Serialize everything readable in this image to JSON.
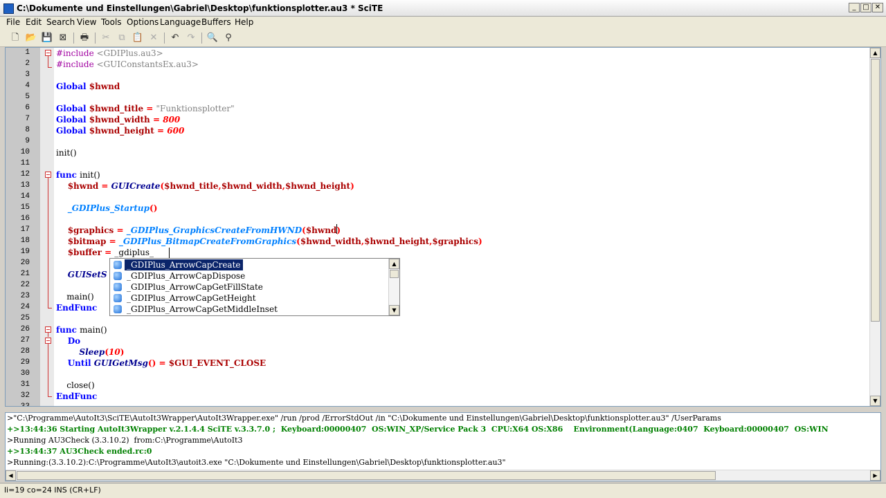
{
  "window": {
    "title": "C:\\Dokumente und Einstellungen\\Gabriel\\Desktop\\funktionsplotter.au3 * SciTE",
    "minimize": "_",
    "maximize": "□",
    "close": "✕"
  },
  "menu": [
    "File",
    "Edit",
    "Search",
    "View",
    "Tools",
    "Options",
    "Language",
    "Buffers",
    "Help"
  ],
  "toolbar": {
    "icons": [
      "new-file-icon",
      "open-icon",
      "save-icon",
      "close-file-icon",
      "print-icon",
      "cut-icon",
      "copy-icon",
      "paste-icon",
      "delete-icon",
      "undo-icon",
      "redo-icon",
      "find-icon",
      "replace-icon"
    ]
  },
  "editor": {
    "lines": [
      [
        {
          "t": "#include ",
          "c": "pre"
        },
        {
          "t": "<GDIPlus.au3>",
          "c": "str"
        }
      ],
      [
        {
          "t": "#include ",
          "c": "pre"
        },
        {
          "t": "<GUIConstantsEx.au3>",
          "c": "str"
        }
      ],
      [],
      [
        {
          "t": "Global ",
          "c": "kw"
        },
        {
          "t": "$hwnd",
          "c": "var"
        }
      ],
      [],
      [
        {
          "t": "Global ",
          "c": "kw"
        },
        {
          "t": "$hwnd_title",
          "c": "var"
        },
        {
          "t": " = ",
          "c": "op"
        },
        {
          "t": "\"Funktionsplotter\"",
          "c": "str"
        }
      ],
      [
        {
          "t": "Global ",
          "c": "kw"
        },
        {
          "t": "$hwnd_width",
          "c": "var"
        },
        {
          "t": " = ",
          "c": "op"
        },
        {
          "t": "800",
          "c": "num"
        }
      ],
      [
        {
          "t": "Global ",
          "c": "kw"
        },
        {
          "t": "$hwnd_height",
          "c": "var"
        },
        {
          "t": " = ",
          "c": "op"
        },
        {
          "t": "600",
          "c": "num"
        }
      ],
      [],
      [
        {
          "t": "init()",
          "c": "plain"
        }
      ],
      [],
      [
        {
          "t": "func ",
          "c": "kw"
        },
        {
          "t": "init()",
          "c": "plain"
        }
      ],
      [
        {
          "t": "    $hwnd",
          "c": "var"
        },
        {
          "t": " = ",
          "c": "op"
        },
        {
          "t": "GUICreate",
          "c": "fn"
        },
        {
          "t": "(",
          "c": "op"
        },
        {
          "t": "$hwnd_title",
          "c": "var"
        },
        {
          "t": ",",
          "c": "op"
        },
        {
          "t": "$hwnd_width",
          "c": "var"
        },
        {
          "t": ",",
          "c": "op"
        },
        {
          "t": "$hwnd_height",
          "c": "var"
        },
        {
          "t": ")",
          "c": "op"
        }
      ],
      [],
      [
        {
          "t": "    _GDIPlus_Startup",
          "c": "udf"
        },
        {
          "t": "()",
          "c": "op"
        }
      ],
      [],
      [
        {
          "t": "    $graphics",
          "c": "var"
        },
        {
          "t": " = ",
          "c": "op"
        },
        {
          "t": "_GDIPlus_GraphicsCreateFromHWND",
          "c": "udf"
        },
        {
          "t": "(",
          "c": "op"
        },
        {
          "t": "$hwnd",
          "c": "var"
        },
        {
          "t": ")",
          "c": "op"
        }
      ],
      [
        {
          "t": "    $bitmap",
          "c": "var"
        },
        {
          "t": " = ",
          "c": "op"
        },
        {
          "t": "_GDIPlus_BitmapCreateFromGraphics",
          "c": "udf"
        },
        {
          "t": "(",
          "c": "op"
        },
        {
          "t": "$hwnd_width",
          "c": "var"
        },
        {
          "t": ",",
          "c": "op"
        },
        {
          "t": "$hwnd_height",
          "c": "var"
        },
        {
          "t": ",",
          "c": "op"
        },
        {
          "t": "$graphics",
          "c": "var"
        },
        {
          "t": ")",
          "c": "op"
        }
      ],
      [
        {
          "t": "    $buffer",
          "c": "var"
        },
        {
          "t": " = ",
          "c": "op"
        },
        {
          "t": "_gdiplus_",
          "c": "plain"
        }
      ],
      [],
      [
        {
          "t": "    GUISetS",
          "c": "fn"
        }
      ],
      [],
      [
        {
          "t": "    main()",
          "c": "plain"
        }
      ],
      [
        {
          "t": "EndFunc",
          "c": "kw"
        }
      ],
      [],
      [
        {
          "t": "func ",
          "c": "kw"
        },
        {
          "t": "main()",
          "c": "plain"
        }
      ],
      [
        {
          "t": "    Do",
          "c": "kw"
        }
      ],
      [
        {
          "t": "        Sleep",
          "c": "fn"
        },
        {
          "t": "(",
          "c": "op"
        },
        {
          "t": "10",
          "c": "num"
        },
        {
          "t": ")",
          "c": "op"
        }
      ],
      [
        {
          "t": "    Until ",
          "c": "kw"
        },
        {
          "t": "GUIGetMsg",
          "c": "fn"
        },
        {
          "t": "() = ",
          "c": "op"
        },
        {
          "t": "$GUI_EVENT_CLOSE",
          "c": "var"
        }
      ],
      [],
      [
        {
          "t": "    close()",
          "c": "plain"
        }
      ],
      [
        {
          "t": "EndFunc",
          "c": "kw"
        }
      ],
      []
    ]
  },
  "autocomplete": {
    "items": [
      "_GDIPlus_ArrowCapCreate",
      "_GDIPlus_ArrowCapDispose",
      "_GDIPlus_ArrowCapGetFillState",
      "_GDIPlus_ArrowCapGetHeight",
      "_GDIPlus_ArrowCapGetMiddleInset"
    ],
    "selected": 0
  },
  "output": {
    "lines": [
      {
        "t": ">\"C:\\Programme\\AutoIt3\\SciTE\\AutoIt3Wrapper\\AutoIt3Wrapper.exe\" /run /prod /ErrorStdOut /in \"C:\\Dokumente und Einstellungen\\Gabriel\\Desktop\\funktionsplotter.au3\" /UserParams",
        "c": "out-cmd"
      },
      {
        "t": "+>13:44:36 Starting AutoIt3Wrapper v.2.1.4.4 SciTE v.3.3.7.0 ;  Keyboard:00000407  OS:WIN_XP/Service Pack 3  CPU:X64 OS:X86    Environment(Language:0407  Keyboard:00000407  OS:WIN",
        "c": "out-info"
      },
      {
        "t": ">Running AU3Check (3.3.10.2)  from:C:\\Programme\\AutoIt3",
        "c": "out-cmd"
      },
      {
        "t": "+>13:44:37 AU3Check ended.rc:0",
        "c": "out-info"
      },
      {
        "t": ">Running:(3.3.10.2):C:\\Programme\\AutoIt3\\autoit3.exe \"C:\\Dokumente und Einstellungen\\Gabriel\\Desktop\\funktionsplotter.au3\"",
        "c": "out-cmd"
      }
    ]
  },
  "status": {
    "text": "li=19 co=24 INS (CR+LF)"
  }
}
